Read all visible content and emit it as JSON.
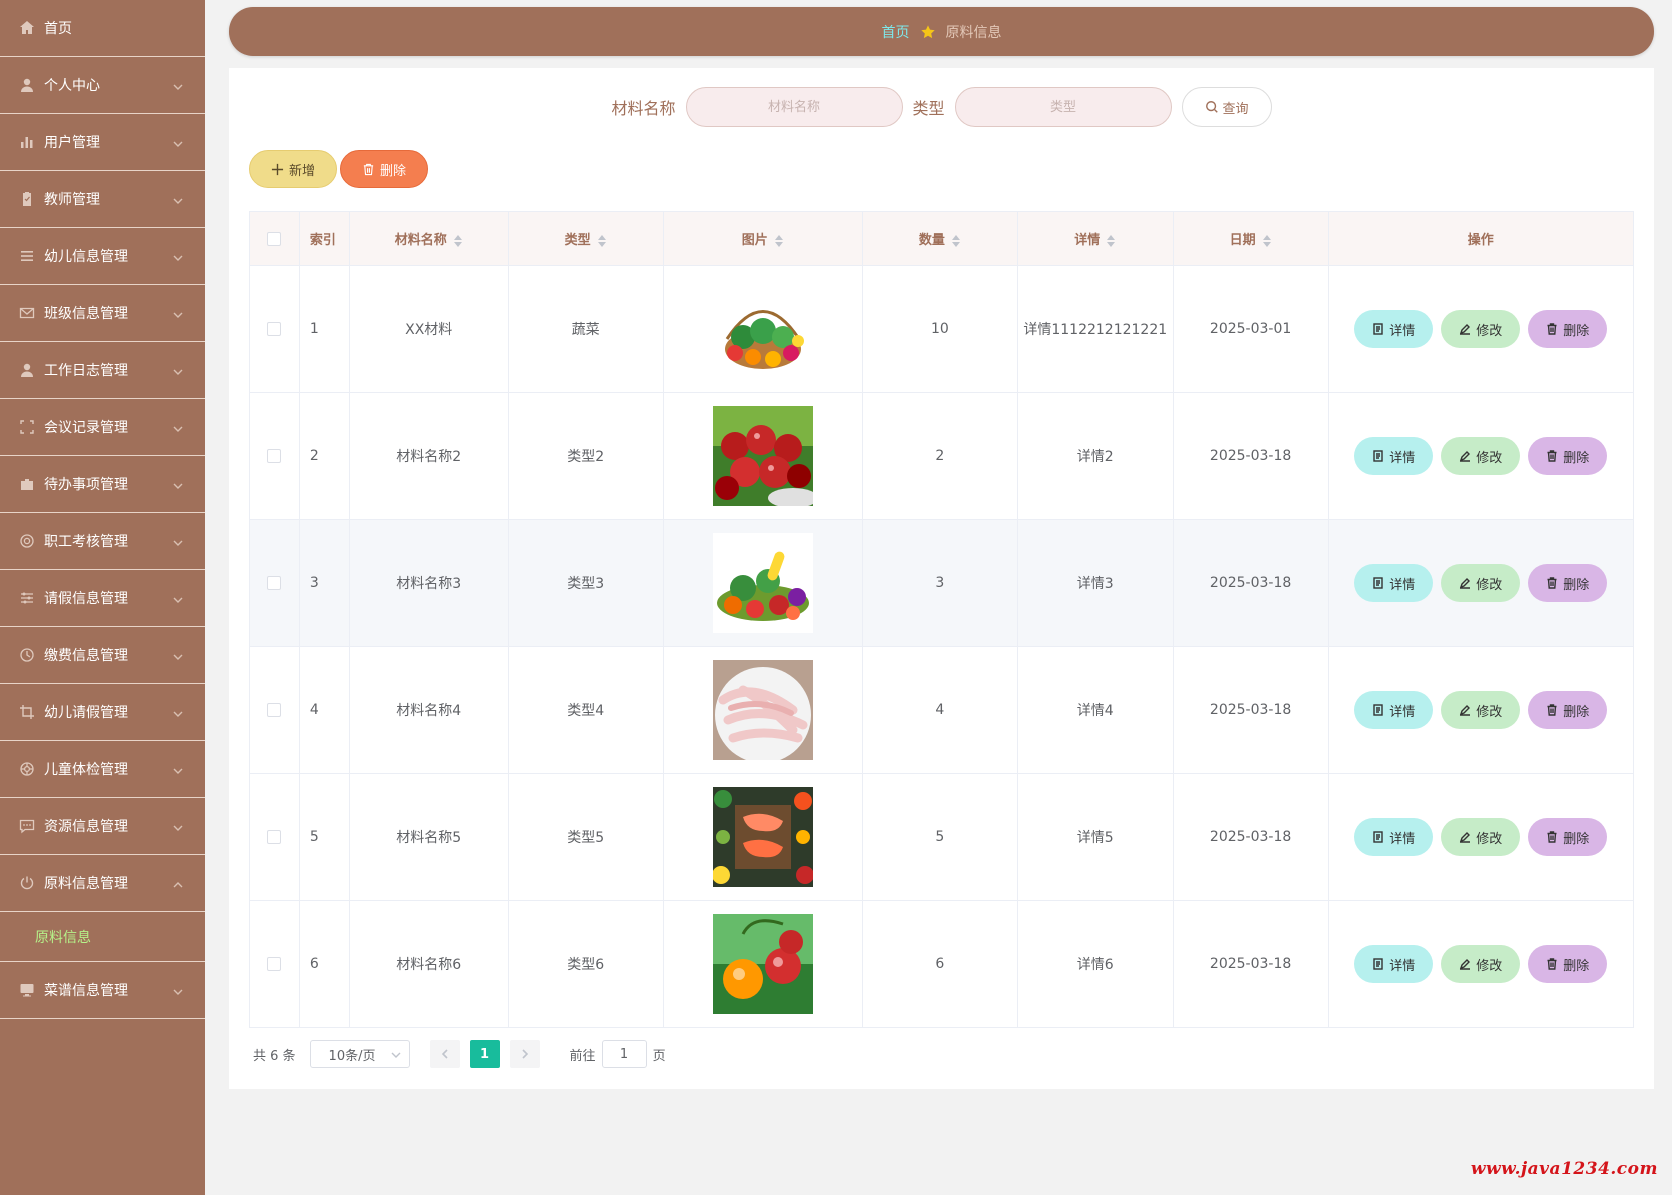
{
  "sidebar": {
    "items": [
      {
        "label": "首页",
        "icon": "home-icon",
        "expandable": false
      },
      {
        "label": "个人中心",
        "icon": "user-icon",
        "expandable": true
      },
      {
        "label": "用户管理",
        "icon": "chart-icon",
        "expandable": true
      },
      {
        "label": "教师管理",
        "icon": "clipboard-icon",
        "expandable": true
      },
      {
        "label": "幼儿信息管理",
        "icon": "list-icon",
        "expandable": true
      },
      {
        "label": "班级信息管理",
        "icon": "mail-icon",
        "expandable": true
      },
      {
        "label": "工作日志管理",
        "icon": "user-icon",
        "expandable": true
      },
      {
        "label": "会议记录管理",
        "icon": "fullscreen-icon",
        "expandable": true
      },
      {
        "label": "待办事项管理",
        "icon": "briefcase-icon",
        "expandable": true
      },
      {
        "label": "职工考核管理",
        "icon": "settings-circle-icon",
        "expandable": true
      },
      {
        "label": "请假信息管理",
        "icon": "sliders-icon",
        "expandable": true
      },
      {
        "label": "缴费信息管理",
        "icon": "clock-icon",
        "expandable": true
      },
      {
        "label": "幼儿请假管理",
        "icon": "crop-icon",
        "expandable": true
      },
      {
        "label": "儿童体检管理",
        "icon": "support-icon",
        "expandable": true
      },
      {
        "label": "资源信息管理",
        "icon": "chat-icon",
        "expandable": true
      },
      {
        "label": "原料信息管理",
        "icon": "power-icon",
        "expandable": true,
        "open": true
      },
      {
        "label": "菜谱信息管理",
        "icon": "monitor-icon",
        "expandable": true
      }
    ],
    "submenu_active": "原料信息"
  },
  "breadcrumb": {
    "home": "首页",
    "current": "原料信息"
  },
  "search": {
    "name_label": "材料名称",
    "name_placeholder": "材料名称",
    "type_label": "类型",
    "type_placeholder": "类型",
    "button": "查询"
  },
  "actions": {
    "add": "新增",
    "delete": "删除"
  },
  "table": {
    "headers": {
      "index": "索引",
      "name": "材料名称",
      "type": "类型",
      "image": "图片",
      "quantity": "数量",
      "detail": "详情",
      "date": "日期",
      "ops": "操作"
    },
    "rows": [
      {
        "index": "1",
        "name": "XX材料",
        "type": "蔬菜",
        "image": "vegetable-basket",
        "quantity": "10",
        "detail": "详情1112212121221",
        "date": "2025-03-01"
      },
      {
        "index": "2",
        "name": "材料名称2",
        "type": "类型2",
        "image": "cherries",
        "quantity": "2",
        "detail": "详情2",
        "date": "2025-03-18"
      },
      {
        "index": "3",
        "name": "材料名称3",
        "type": "类型3",
        "image": "vegetable-pile",
        "quantity": "3",
        "detail": "详情3",
        "date": "2025-03-18"
      },
      {
        "index": "4",
        "name": "材料名称4",
        "type": "类型4",
        "image": "chicken-feet",
        "quantity": "4",
        "detail": "详情4",
        "date": "2025-03-18"
      },
      {
        "index": "5",
        "name": "材料名称5",
        "type": "类型5",
        "image": "salmon-and-vegetables",
        "quantity": "5",
        "detail": "详情5",
        "date": "2025-03-18"
      },
      {
        "index": "6",
        "name": "材料名称6",
        "type": "类型6",
        "image": "cherries-closeup",
        "quantity": "6",
        "detail": "详情6",
        "date": "2025-03-18"
      }
    ],
    "row_buttons": {
      "detail": "详情",
      "edit": "修改",
      "remove": "删除"
    }
  },
  "pagination": {
    "total": "共 6 条",
    "page_size": "10条/页",
    "current_page": "1",
    "goto_label": "前往",
    "goto_value": "1",
    "page_suffix": "页"
  },
  "watermark": "www.java1234.com",
  "colors": {
    "sidebar": "#a0705a",
    "accent_cyan": "#7ee7e9",
    "submenu_active": "#b6f28a",
    "pager_active": "#18bc9c",
    "btn_add": "#f0dc8a",
    "btn_delete": "#f47e4f"
  }
}
